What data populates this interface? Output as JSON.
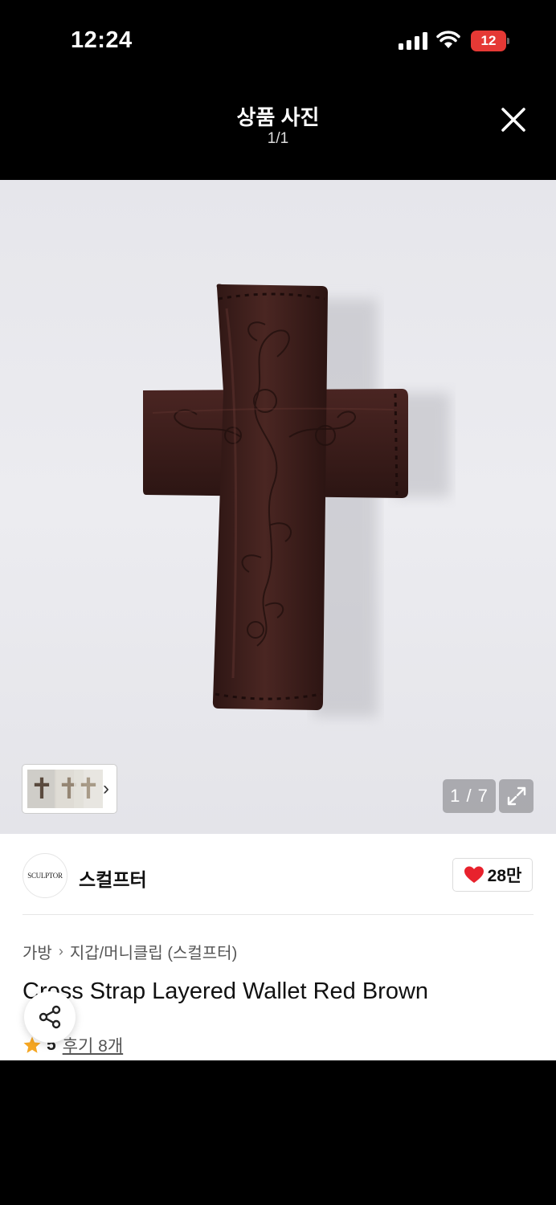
{
  "status_bar": {
    "time": "12:24",
    "battery": "12",
    "icons": [
      "signal-icon",
      "wifi-icon",
      "battery-icon"
    ]
  },
  "header": {
    "title": "상품 사진",
    "count": "1/1",
    "close_icon": "close-icon"
  },
  "gallery": {
    "counter": "1 / 7",
    "expand_icon": "expand-icon",
    "thumb_chevron": "›"
  },
  "brand": {
    "logo_text": "SCULPTOR",
    "name": "스컬프터",
    "likes": "28만"
  },
  "breadcrumb": {
    "items": [
      "가방",
      "지갑/머니클립 (스컬프터)"
    ],
    "separator": "›"
  },
  "product": {
    "title": "Cross Strap Layered Wallet Red Brown",
    "rating": "5",
    "reviews": "후기 8개"
  },
  "colors": {
    "accent_red": "#e53935",
    "heart": "#e8222d",
    "star": "#f5a623",
    "leather": "#3e1f1c"
  }
}
